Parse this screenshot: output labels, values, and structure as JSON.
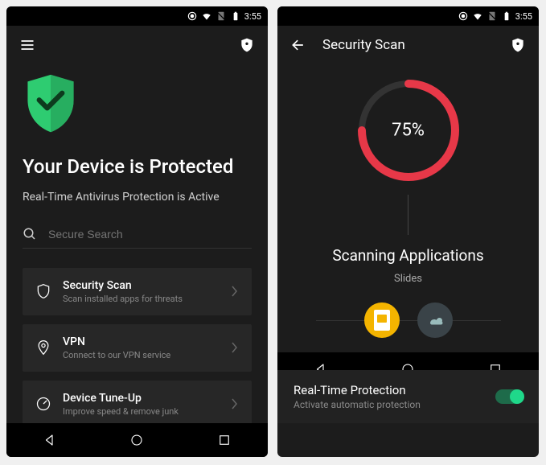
{
  "status": {
    "time": "3:55"
  },
  "screen1": {
    "title": "Your Device is Protected",
    "subtitle": "Real-Time Antivirus Protection is Active",
    "search_placeholder": "Secure Search",
    "cards": [
      {
        "title": "Security Scan",
        "sub": "Scan installed apps for threats"
      },
      {
        "title": "VPN",
        "sub": "Connect to our VPN service"
      },
      {
        "title": "Device Tune-Up",
        "sub": "Improve speed & remove junk"
      }
    ]
  },
  "screen2": {
    "header": "Security Scan",
    "progress_pct": "75%",
    "progress_value": 75,
    "scan_title": "Scanning Applications",
    "current_app": "Slides",
    "rtp_title": "Real-Time Protection",
    "rtp_sub": "Activate automatic protection"
  },
  "colors": {
    "accent_green": "#2ecc71",
    "accent_red": "#e73848",
    "toggle_on": "#1fd88a"
  }
}
